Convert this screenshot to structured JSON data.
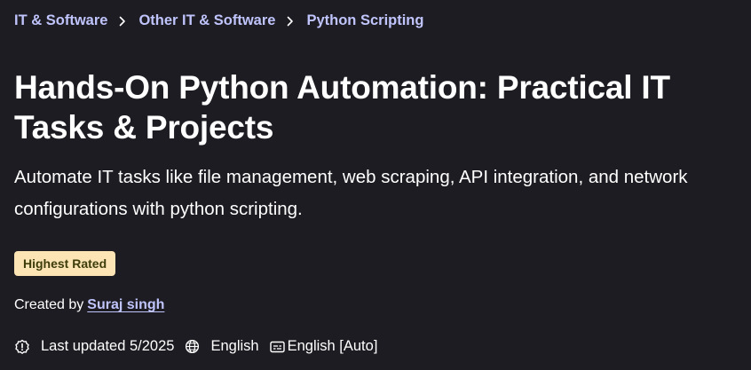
{
  "breadcrumb": {
    "items": [
      {
        "label": "IT & Software"
      },
      {
        "label": "Other IT & Software"
      },
      {
        "label": "Python Scripting"
      }
    ]
  },
  "course": {
    "title": "Hands-On Python Automation: Practical IT Tasks & Projects",
    "subtitle": "Automate IT tasks like file management, web scraping, API integration, and network configurations with python scripting.",
    "badge": "Highest Rated",
    "created_by_label": "Created by",
    "instructor": "Suraj singh",
    "last_updated": "Last updated 5/2025",
    "language": "English",
    "captions": "English [Auto]"
  },
  "icons": {
    "separator": "chevron-right-icon",
    "updated": "alert-badge-icon",
    "language": "globe-icon",
    "captions": "closed-caption-icon"
  },
  "colors": {
    "background": "#1d1c22",
    "link": "#c0c4fc",
    "badge_bg": "#fce4b4",
    "badge_text": "#3d3c0a",
    "text": "#ffffff"
  }
}
